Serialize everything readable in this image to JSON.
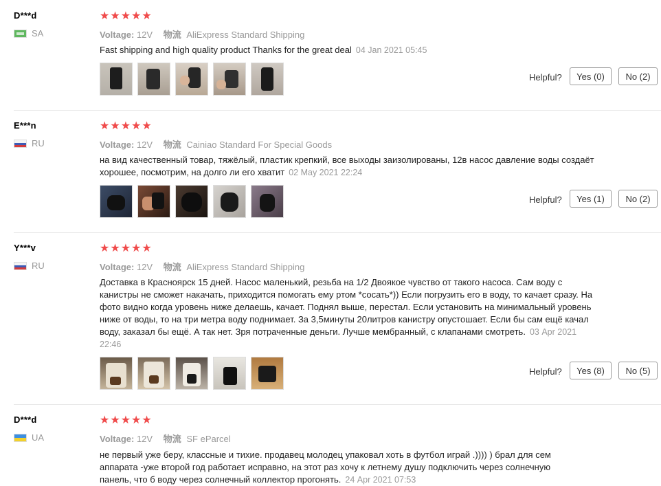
{
  "labels": {
    "voltage": "Voltage:",
    "logistics": "物流",
    "helpful": "Helpful?"
  },
  "reviews": [
    {
      "name": "D***d",
      "country": "SA",
      "stars": "★★★★★",
      "voltage": "12V",
      "shipping": "AliExpress Standard Shipping",
      "text": "Fast shipping and high quality product Thanks for the great deal",
      "date": "04 Jan 2021 05:45",
      "yes": "Yes (0)",
      "no": "No (2)"
    },
    {
      "name": "E***n",
      "country": "RU",
      "stars": "★★★★★",
      "voltage": "12V",
      "shipping": "Cainiao Standard For Special Goods",
      "text": "на вид качественный товар, тяжёлый, пластик крепкий, все выходы заизолированы, 12в насос давление воды создаёт хорошее, посмотрим, на долго ли его хватит",
      "date": "02 May 2021 22:24",
      "yes": "Yes (1)",
      "no": "No (2)"
    },
    {
      "name": "Y***v",
      "country": "RU",
      "stars": "★★★★★",
      "voltage": "12V",
      "shipping": "AliExpress Standard Shipping",
      "text": "Доставка в Красноярск 15 дней. Насос маленький, резьба на 1/2 Двоякое чувство от такого насоса. Сам воду с канистры не сможет накачать, приходится помогать ему ртом *сосать*)) Если погрузить его в воду, то качает сразу. На фото видно когда уровень ниже делаешь, качает. Поднял выше, перестал. Если установить на минимальный уровень ниже от воды, то на три метра воду поднимает. За 3,5минуты 20литров канистру опустошает. Если бы сам ещё качал воду, заказал бы ещё. А так нет. Зря потраченные деньги. Лучше мембранный, с клапанами смотреть.",
      "date": "03 Apr 2021 22:46",
      "yes": "Yes (8)",
      "no": "No (5)"
    },
    {
      "name": "D***d",
      "country": "UA",
      "stars": "★★★★★",
      "voltage": "12V",
      "shipping": "SF eParcel",
      "text": "не первый уже беру, классные и тихие. продавец молодец упаковал хоть в футбол играй .)))) ) брал для сем аппарата -уже второй год работает исправно, на этот раз хочу к летнему душу подключить через солнечную панель, что б воду через солнечный коллектор прогонять.",
      "date": "24 Apr 2021 07:53"
    }
  ]
}
